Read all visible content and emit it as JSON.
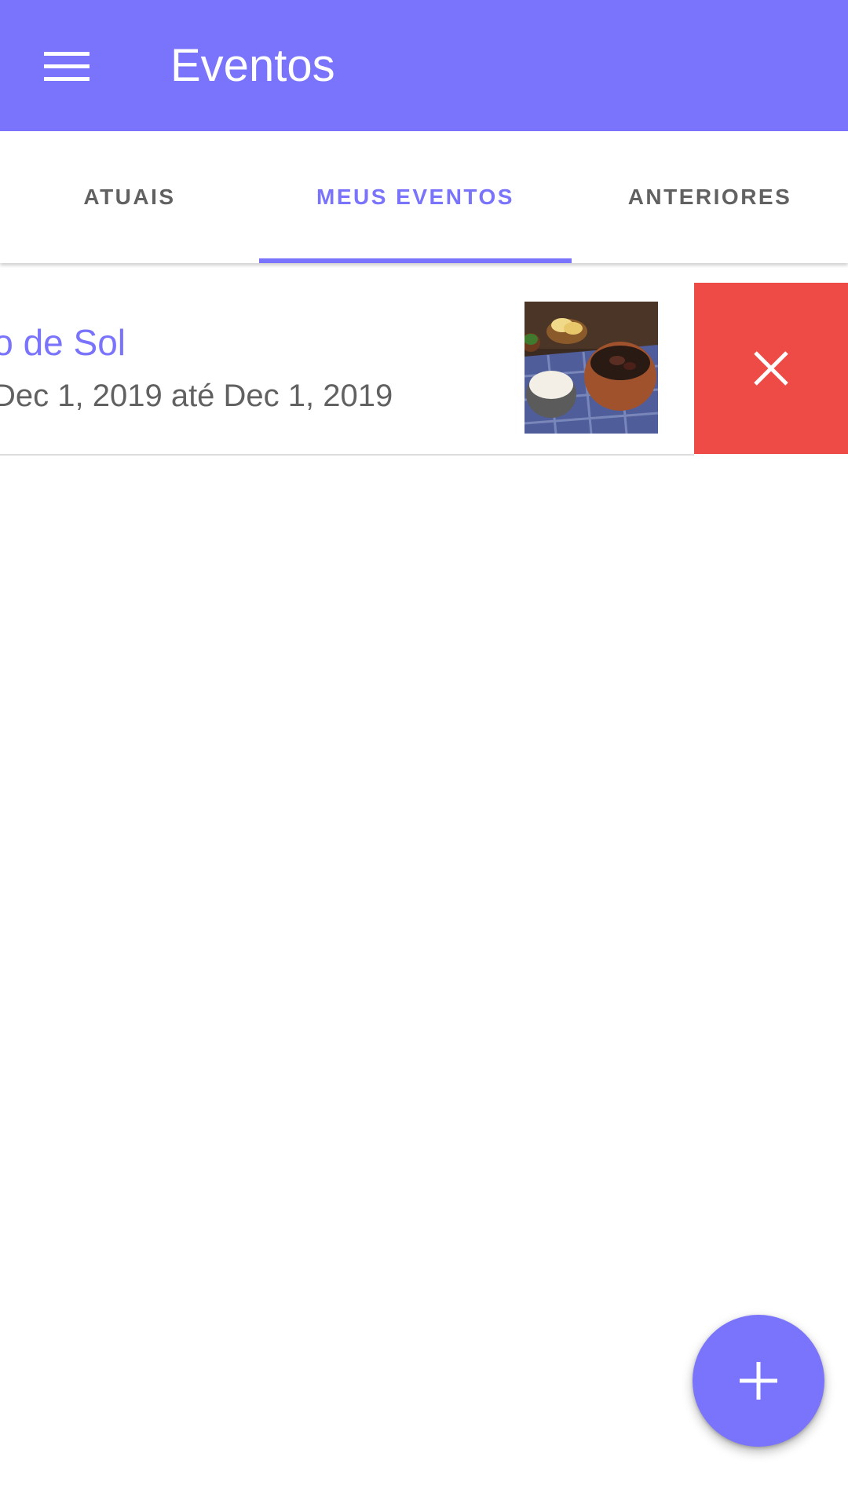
{
  "app_bar": {
    "title": "Eventos",
    "menu_icon": "hamburger-menu-icon",
    "color": "#7a73fb"
  },
  "tabs": {
    "items": [
      {
        "label": "ATUAIS"
      },
      {
        "label": "MEUS EVENTOS",
        "selected": true
      },
      {
        "label": "ANTERIORES"
      }
    ],
    "active_color": "#7a73fb"
  },
  "events": [
    {
      "title_visible": "o de Sol",
      "dates_visible": "Dec 1, 2019 até Dec 1, 2019",
      "thumbnail": "food-photo-feijoada"
    }
  ],
  "swipe_action": {
    "icon": "close-icon",
    "color": "#ef4b46"
  },
  "fab": {
    "icon": "plus-icon"
  }
}
